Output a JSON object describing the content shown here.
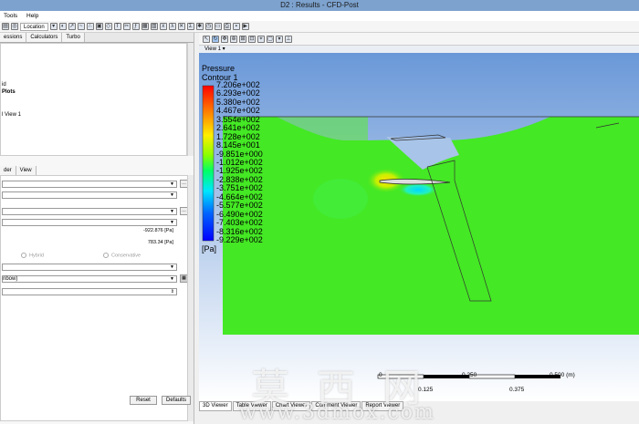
{
  "window": {
    "title": "D2 : Results - CFD-Post"
  },
  "menu": {
    "items": [
      "Tools",
      "Help"
    ]
  },
  "toolbar": {
    "location_label": "Location"
  },
  "left_tabs": [
    "essions",
    "Calculators",
    "Turbo"
  ],
  "tree": {
    "items": [
      "id",
      "Plots",
      "l View 1"
    ]
  },
  "details_tabs": [
    "der",
    "View"
  ],
  "details": {
    "min_value": "-922.876 [Pa]",
    "max_value": "783.34 [Pa]",
    "radio_hybrid": "Hybrid",
    "radio_conservative": "Conservative",
    "colormap": "nbow)",
    "reset_label": "Reset",
    "defaults_label": "Defaults"
  },
  "view": {
    "label": "View 1",
    "bottom_tabs": [
      "3D Viewer",
      "Table Viewer",
      "Chart Viewer",
      "Comment Viewer",
      "Report Viewer"
    ]
  },
  "legend": {
    "title": "Pressure",
    "subtitle": "Contour 1",
    "unit": "[Pa]",
    "labels": [
      "7.206e+002",
      "6.293e+002",
      "5.380e+002",
      "4.467e+002",
      "3.554e+002",
      "2.641e+002",
      "1.728e+002",
      "8.145e+001",
      "-9.851e+000",
      "-1.012e+002",
      "-1.925e+002",
      "-2.838e+002",
      "-3.751e+002",
      "-4.664e+002",
      "-5.577e+002",
      "-6.490e+002",
      "-7.403e+002",
      "-8.316e+002",
      "-9.229e+002"
    ]
  },
  "scale_bar": {
    "top_labels": [
      "0",
      "0.250",
      "0.500  (m)"
    ],
    "bottom_labels": [
      "0.125",
      "0.375"
    ]
  },
  "watermark": {
    "chars": "莫西网",
    "url": "www.3dmox.com"
  },
  "colors": {
    "field_green": "#44e824",
    "sky_blue": "#5fa0e6",
    "titlebar": "#7da2ce"
  }
}
